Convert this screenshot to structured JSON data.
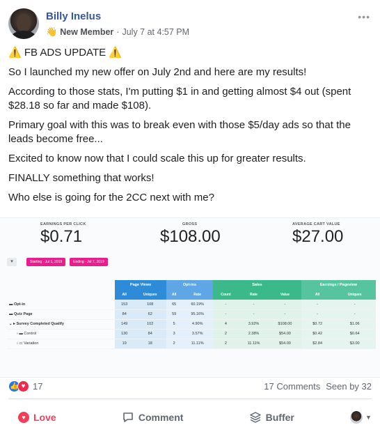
{
  "author": {
    "name": "Billy Inelus",
    "badge": "New Member",
    "timestamp": "July 7 at 4:57 PM"
  },
  "post": {
    "title": "FB ADS UPDATE",
    "paragraphs": [
      "So I launched my new offer on July 2nd and here are my results!",
      "According to those stats, I'm putting $1 in and getting almost $4 out (spent $28.18 so far and made $108).",
      "Primary goal with this was to break even with those $5/day ads so that the leads become free...",
      "Excited to know now that I could scale this up for greater results.",
      "FINALLY something that works!",
      "Who else is going for the 2CC next with me?"
    ]
  },
  "stats": {
    "kpis": [
      {
        "label": "Earnings per click",
        "value": "$0.71"
      },
      {
        "label": "Gross",
        "value": "$108.00"
      },
      {
        "label": "Average cart value",
        "value": "$27.00"
      }
    ],
    "filter_start": "Starting · Jul 1, 2019",
    "filter_end": "Ending · Jul 7, 2019",
    "groups": [
      "Page Views",
      "Opt-ins",
      "Sales",
      "Earnings / Pageview"
    ],
    "subheaders": [
      "All",
      "Uniques",
      "All",
      "Rate",
      "Count",
      "Rate",
      "Value",
      "All",
      "Uniques"
    ],
    "rows": [
      {
        "label": "Opt-in",
        "cells": [
          "153",
          "108",
          "65",
          "60.19%",
          "-",
          "-",
          "-",
          "-",
          "-"
        ]
      },
      {
        "label": "Quiz Page",
        "cells": [
          "84",
          "62",
          "59",
          "95.16%",
          "-",
          "-",
          "-",
          "-",
          "-"
        ]
      },
      {
        "label": "Survey Completed Qualify",
        "cells": [
          "149",
          "102",
          "5",
          "4.90%",
          "4",
          "3.92%",
          "$108.00",
          "$0.72",
          "$1.06"
        ]
      },
      {
        "label": "Control",
        "cells": [
          "130",
          "84",
          "3",
          "3.57%",
          "2",
          "2.38%",
          "$54.00",
          "$0.42",
          "$0.64"
        ]
      },
      {
        "label": "Variation",
        "cells": [
          "19",
          "18",
          "2",
          "11.11%",
          "2",
          "11.11%",
          "$54.00",
          "$2.84",
          "$3.00"
        ]
      }
    ]
  },
  "engagement": {
    "reactions": "17",
    "comments": "17 Comments",
    "seen": "Seen by 32"
  },
  "actions": {
    "love": "Love",
    "comment": "Comment",
    "buffer": "Buffer"
  },
  "icons": {
    "like": "like-icon",
    "love": "love-icon",
    "comment": "comment-icon",
    "buffer": "buffer-icon",
    "warning": "warning-icon"
  },
  "colors": {
    "name": "#365899",
    "love": "#f33e58",
    "like": "#2078f4",
    "pill": "#e91e8c"
  }
}
